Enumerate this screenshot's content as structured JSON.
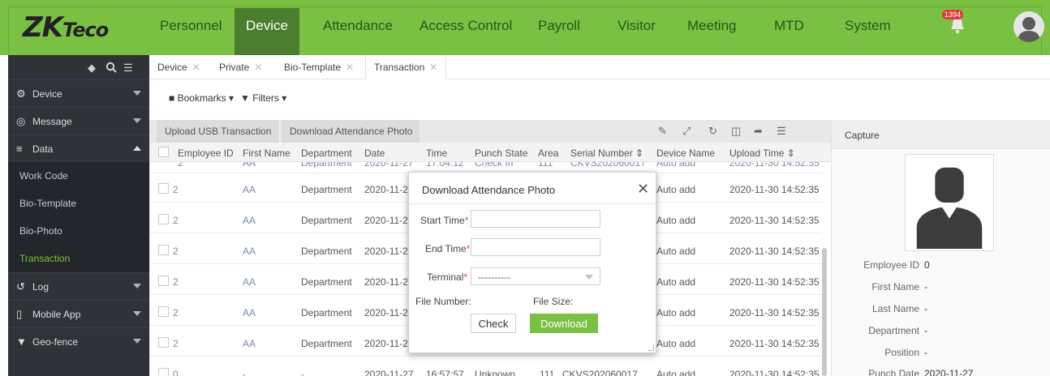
{
  "header": {
    "logo_main": "ZK",
    "logo_sub": "Teco",
    "nav": [
      "Personnel",
      "Device",
      "Attendance",
      "Access Control",
      "Payroll",
      "Visitor",
      "Meeting",
      "MTD",
      "System"
    ],
    "active_nav": "Device",
    "notification_count": "1394"
  },
  "sidebar": {
    "tool_icons": [
      "tag-icon",
      "search-icon",
      "list-icon"
    ],
    "items": [
      {
        "label": "Device",
        "icon": "device-icon"
      },
      {
        "label": "Message",
        "icon": "message-icon"
      },
      {
        "label": "Data",
        "icon": "database-icon"
      },
      {
        "label": "Log",
        "icon": "log-icon"
      },
      {
        "label": "Mobile App",
        "icon": "mobile-icon"
      },
      {
        "label": "Geo-fence",
        "icon": "location-pin-icon"
      }
    ],
    "sub_items": [
      "Work Code",
      "Bio-Template",
      "Bio-Photo",
      "Transaction"
    ],
    "active_sub": "Transaction"
  },
  "tabs": [
    {
      "label": "Device"
    },
    {
      "label": "Private"
    },
    {
      "label": "Bio-Template"
    },
    {
      "label": "Transaction"
    }
  ],
  "toolbar": {
    "bookmarks": "Bookmarks",
    "filters": "Filters"
  },
  "grid": {
    "actions": [
      "Upload USB Transaction",
      "Download Attendance Photo"
    ],
    "columns": [
      "Employee ID",
      "First Name",
      "Department",
      "Date",
      "Time",
      "Punch State",
      "Area",
      "Serial Number",
      "Device Name",
      "Upload Time"
    ],
    "partial_row": [
      "2",
      "AA",
      "Department",
      "2020-11-27",
      "17:04:12",
      "Check In",
      "111",
      "CKVS202060017",
      "Auto add",
      "2020-11-30 14:52:35"
    ],
    "rows": [
      {
        "employee_id": "2",
        "first_name": "AA",
        "department": "Department",
        "date": "2020-11-27",
        "device": "Auto add",
        "upload": "2020-11-30 14:52:35"
      },
      {
        "employee_id": "2",
        "first_name": "AA",
        "department": "Department",
        "date": "2020-11-27",
        "device": "Auto add",
        "upload": "2020-11-30 14:52:35"
      },
      {
        "employee_id": "2",
        "first_name": "AA",
        "department": "Department",
        "date": "2020-11-27",
        "device": "Auto add",
        "upload": "2020-11-30 14:52:35"
      },
      {
        "employee_id": "2",
        "first_name": "AA",
        "department": "Department",
        "date": "2020-11-27",
        "device": "Auto add",
        "upload": "2020-11-30 14:52:35"
      },
      {
        "employee_id": "2",
        "first_name": "AA",
        "department": "Department",
        "date": "2020-11-27",
        "device": "Auto add",
        "upload": "2020-11-30 14:52:35"
      },
      {
        "employee_id": "2",
        "first_name": "AA",
        "department": "Department",
        "date": "2020-11-27",
        "device": "Auto add",
        "upload": "2020-11-30 14:52:35"
      }
    ],
    "last_row": {
      "employee_id": "0",
      "first_name": "-",
      "department": "-",
      "date": "2020-11-27",
      "time": "16:57:57",
      "punch_state": "Unknown",
      "area": "111",
      "serial": "CKVS202060017",
      "device": "Auto add",
      "upload": "2020-11-30 14:52:35"
    }
  },
  "capture": {
    "title": "Capture",
    "fields": [
      {
        "label": "Employee ID",
        "value": "0"
      },
      {
        "label": "First Name",
        "value": "-"
      },
      {
        "label": "Last Name",
        "value": "-"
      },
      {
        "label": "Department",
        "value": "-"
      },
      {
        "label": "Position",
        "value": "-"
      },
      {
        "label": "Punch Date",
        "value": "2020-11-27"
      }
    ]
  },
  "modal": {
    "title": "Download Attendance Photo",
    "start_time_label": "Start Time",
    "end_time_label": "End Time",
    "terminal_label": "Terminal",
    "required_mark": "*",
    "start_time_value": "",
    "end_time_value": "",
    "terminal_value": "----------",
    "file_number_label": "File Number:",
    "file_size_label": "File Size:",
    "check_label": "Check",
    "download_label": "Download"
  },
  "colors": {
    "brand_green": "#7ac143",
    "nav_active": "#4a7d2d",
    "sidebar_bg": "#2f3338"
  }
}
